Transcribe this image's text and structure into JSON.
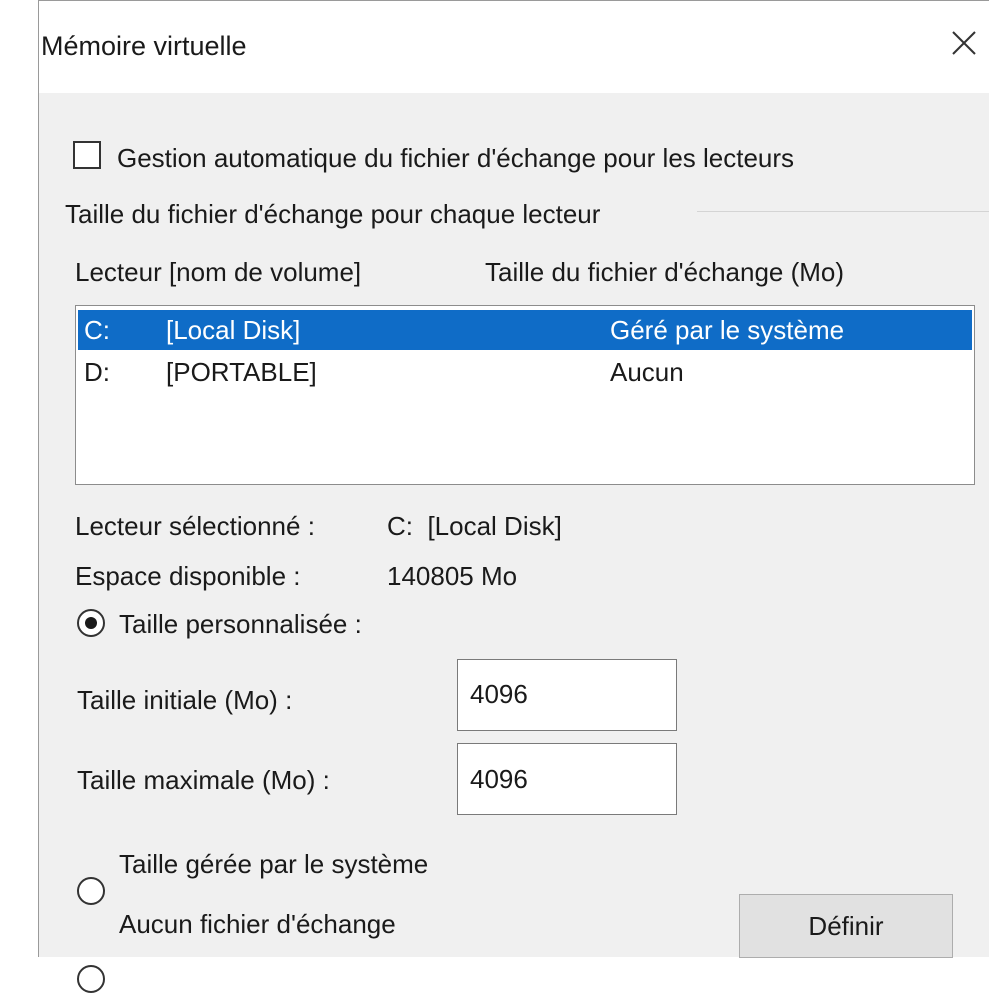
{
  "window": {
    "title": "Mémoire virtuelle",
    "close_icon": "close-icon"
  },
  "auto_manage": {
    "label": "Gestion automatique du fichier d'échange pour les lecteurs",
    "checked": false
  },
  "group": {
    "title": "Taille du fichier d'échange pour chaque lecteur"
  },
  "drive_list": {
    "columns": [
      "Lecteur [nom de volume]",
      "Taille du fichier d'échange (Mo)"
    ],
    "rows": [
      {
        "drive": "C:",
        "volume": "[Local Disk]",
        "size": "Géré par le système",
        "selected": true
      },
      {
        "drive": "D:",
        "volume": "[PORTABLE]",
        "size": "Aucun",
        "selected": false
      }
    ]
  },
  "details": {
    "selected_drive_label": "Lecteur sélectionné :",
    "selected_drive_value": "C:  [Local Disk]",
    "space_label": "Espace disponible :",
    "space_value": "140805 Mo"
  },
  "options": {
    "custom_size_label": "Taille personnalisée :",
    "initial_size_label": "Taille initiale (Mo) :",
    "initial_size_value": "4096",
    "max_size_label": "Taille maximale (Mo) :",
    "max_size_value": "4096",
    "system_managed_label": "Taille gérée par le système",
    "no_paging_label": "Aucun fichier d'échange",
    "selected_option": "custom"
  },
  "buttons": {
    "set_label": "Définir"
  },
  "colors": {
    "selection": "#0f6cc7",
    "dialog_bg": "#f0f0f0"
  }
}
